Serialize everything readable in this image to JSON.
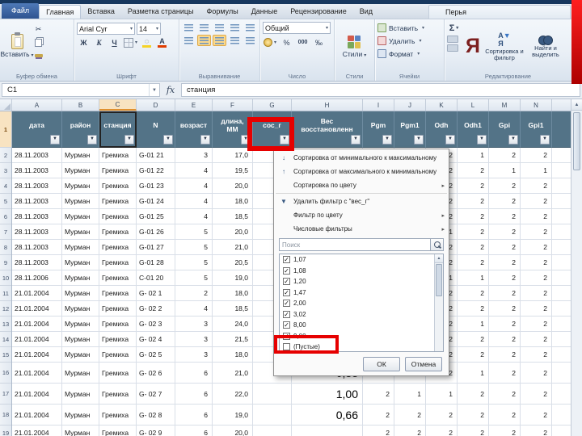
{
  "colors": {
    "annotation_red": "#e60000",
    "table_header_blue": "#537387",
    "file_tab_blue": "#2e5390"
  },
  "ribbon": {
    "tabs": [
      "Файл",
      "Главная",
      "Вставка",
      "Разметка страницы",
      "Формулы",
      "Данные",
      "Рецензирование",
      "Вид"
    ],
    "active_tab": "Главная",
    "addin_tab": "Перья",
    "clipboard": {
      "label": "Буфер обмена",
      "paste": "Вставить"
    },
    "font": {
      "label": "Шрифт",
      "name": "Arial Cyr",
      "size": "14",
      "bold": "Ж",
      "italic": "К",
      "underline": "Ч",
      "color_letter": "А"
    },
    "alignment": {
      "label": "Выравнивание"
    },
    "number": {
      "label": "Число",
      "format": "Общий",
      "percent": "%",
      "thousands": "000"
    },
    "styles": {
      "label": "Стили",
      "button": "Стили"
    },
    "cells": {
      "label": "Ячейки",
      "insert": "Вставить",
      "delete": "Удалить",
      "format": "Формат"
    },
    "editing": {
      "label": "Редактирование",
      "autosum": "Σ",
      "ya": "Я",
      "sort": "Сортировка и фильтр",
      "find": "Найти и выделить"
    }
  },
  "formula_bar": {
    "cell_ref": "C1",
    "fx": "fx",
    "value": "станция"
  },
  "sheet": {
    "col_letters": [
      "A",
      "B",
      "C",
      "D",
      "E",
      "F",
      "G",
      "H",
      "I",
      "J",
      "K",
      "L",
      "M",
      "N"
    ],
    "headers": [
      "дата",
      "район",
      "станция",
      "N",
      "возраст",
      "длина, MM",
      "сос_г",
      "Вес восстановленн",
      "Pgm",
      "Pgm1",
      "Odh",
      "Odh1",
      "Gpi",
      "Gpi1"
    ],
    "rows": [
      {
        "n": "2",
        "cells": [
          "28.11.2003",
          "Мурман",
          "Гремиха",
          "G-01 21",
          "3",
          "17,0",
          "",
          "",
          "",
          "",
          "2",
          "1",
          "2",
          "2"
        ]
      },
      {
        "n": "3",
        "cells": [
          "28.11.2003",
          "Мурман",
          "Гремиха",
          "G-01 22",
          "4",
          "19,5",
          "",
          "",
          "",
          "",
          "2",
          "2",
          "1",
          "1"
        ]
      },
      {
        "n": "4",
        "cells": [
          "28.11.2003",
          "Мурман",
          "Гремиха",
          "G-01 23",
          "4",
          "20,0",
          "",
          "",
          "",
          "",
          "2",
          "2",
          "2",
          "2"
        ]
      },
      {
        "n": "5",
        "cells": [
          "28.11.2003",
          "Мурман",
          "Гремиха",
          "G-01 24",
          "4",
          "18,0",
          "",
          "",
          "",
          "",
          "2",
          "2",
          "2",
          "2"
        ]
      },
      {
        "n": "6",
        "cells": [
          "28.11.2003",
          "Мурман",
          "Гремиха",
          "G-01 25",
          "4",
          "18,5",
          "",
          "",
          "",
          "",
          "2",
          "2",
          "2",
          "2"
        ]
      },
      {
        "n": "7",
        "cells": [
          "28.11.2003",
          "Мурман",
          "Гремиха",
          "G-01 26",
          "5",
          "20,0",
          "",
          "",
          "",
          "",
          "1",
          "2",
          "2",
          "2"
        ]
      },
      {
        "n": "8",
        "cells": [
          "28.11.2003",
          "Мурман",
          "Гремиха",
          "G-01 27",
          "5",
          "21,0",
          "",
          "",
          "",
          "",
          "2",
          "2",
          "2",
          "2"
        ]
      },
      {
        "n": "9",
        "cells": [
          "28.11.2003",
          "Мурман",
          "Гремиха",
          "G-01 28",
          "5",
          "20,5",
          "",
          "",
          "",
          "",
          "2",
          "2",
          "2",
          "2"
        ]
      },
      {
        "n": "10",
        "cells": [
          "28.11.2006",
          "Мурман",
          "Гремиха",
          "C-01 20",
          "5",
          "19,0",
          "",
          "",
          "",
          "",
          "1",
          "1",
          "2",
          "2"
        ]
      },
      {
        "n": "11",
        "cells": [
          "21.01.2004",
          "Мурман",
          "Гремиха",
          "G- 02 1",
          "2",
          "18,0",
          "",
          "",
          "",
          "",
          "2",
          "2",
          "2",
          "2"
        ]
      },
      {
        "n": "12",
        "cells": [
          "21.01.2004",
          "Мурман",
          "Гремиха",
          "G- 02 2",
          "4",
          "18,5",
          "",
          "",
          "",
          "",
          "2",
          "2",
          "2",
          "2"
        ]
      },
      {
        "n": "13",
        "cells": [
          "21.01.2004",
          "Мурман",
          "Гремиха",
          "G- 02 3",
          "3",
          "24,0",
          "",
          "",
          "",
          "",
          "2",
          "1",
          "2",
          "2"
        ]
      },
      {
        "n": "14",
        "cells": [
          "21.01.2004",
          "Мурман",
          "Гремиха",
          "G- 02 4",
          "3",
          "21,5",
          "",
          "",
          "",
          "",
          "2",
          "2",
          "2",
          "2"
        ]
      },
      {
        "n": "15",
        "cells": [
          "21.01.2004",
          "Мурман",
          "Гремиха",
          "G- 02 5",
          "3",
          "18,0",
          "",
          "",
          "",
          "",
          "2",
          "2",
          "2",
          "2"
        ]
      },
      {
        "n": "16",
        "big": true,
        "cells": [
          "21.01.2004",
          "Мурман",
          "Гремиха",
          "G- 02 6",
          "6",
          "21,0",
          "",
          "0,88",
          "2",
          "1",
          "2",
          "1",
          "2",
          "2"
        ]
      },
      {
        "n": "17",
        "big": true,
        "cells": [
          "21.01.2004",
          "Мурман",
          "Гремиха",
          "G- 02 7",
          "6",
          "22,0",
          "",
          "1,00",
          "2",
          "1",
          "1",
          "2",
          "2",
          "2"
        ]
      },
      {
        "n": "18",
        "big": true,
        "cells": [
          "21.01.2004",
          "Мурман",
          "Гремиха",
          "G- 02 8",
          "6",
          "19,0",
          "",
          "0,66",
          "2",
          "2",
          "2",
          "2",
          "2",
          "2"
        ]
      },
      {
        "n": "19",
        "cells": [
          "21.01.2004",
          "Мурман",
          "Гремиха",
          "G- 02 9",
          "6",
          "20,0",
          "",
          "",
          "2",
          "2",
          "2",
          "2",
          "2",
          "2"
        ]
      }
    ]
  },
  "filter_menu": {
    "sort_asc": "Сортировка от минимального к максимальному",
    "sort_desc": "Сортировка от максимального к минимальному",
    "sort_color": "Сортировка по цвету",
    "remove_filter": "Удалить фильтр с \"вес_г\"",
    "filter_color": "Фильтр по цвету",
    "number_filters": "Числовые фильтры",
    "search_placeholder": "Поиск",
    "values": [
      {
        "label": "1,07",
        "checked": true
      },
      {
        "label": "1,08",
        "checked": true
      },
      {
        "label": "1,20",
        "checked": true
      },
      {
        "label": "1,47",
        "checked": true
      },
      {
        "label": "2,00",
        "checked": true
      },
      {
        "label": "3,02",
        "checked": true
      },
      {
        "label": "8,00",
        "checked": true
      },
      {
        "label": "9,00",
        "checked": true
      },
      {
        "label": "(Пустые)",
        "checked": false
      }
    ],
    "ok": "ОК",
    "cancel": "Отмена"
  }
}
